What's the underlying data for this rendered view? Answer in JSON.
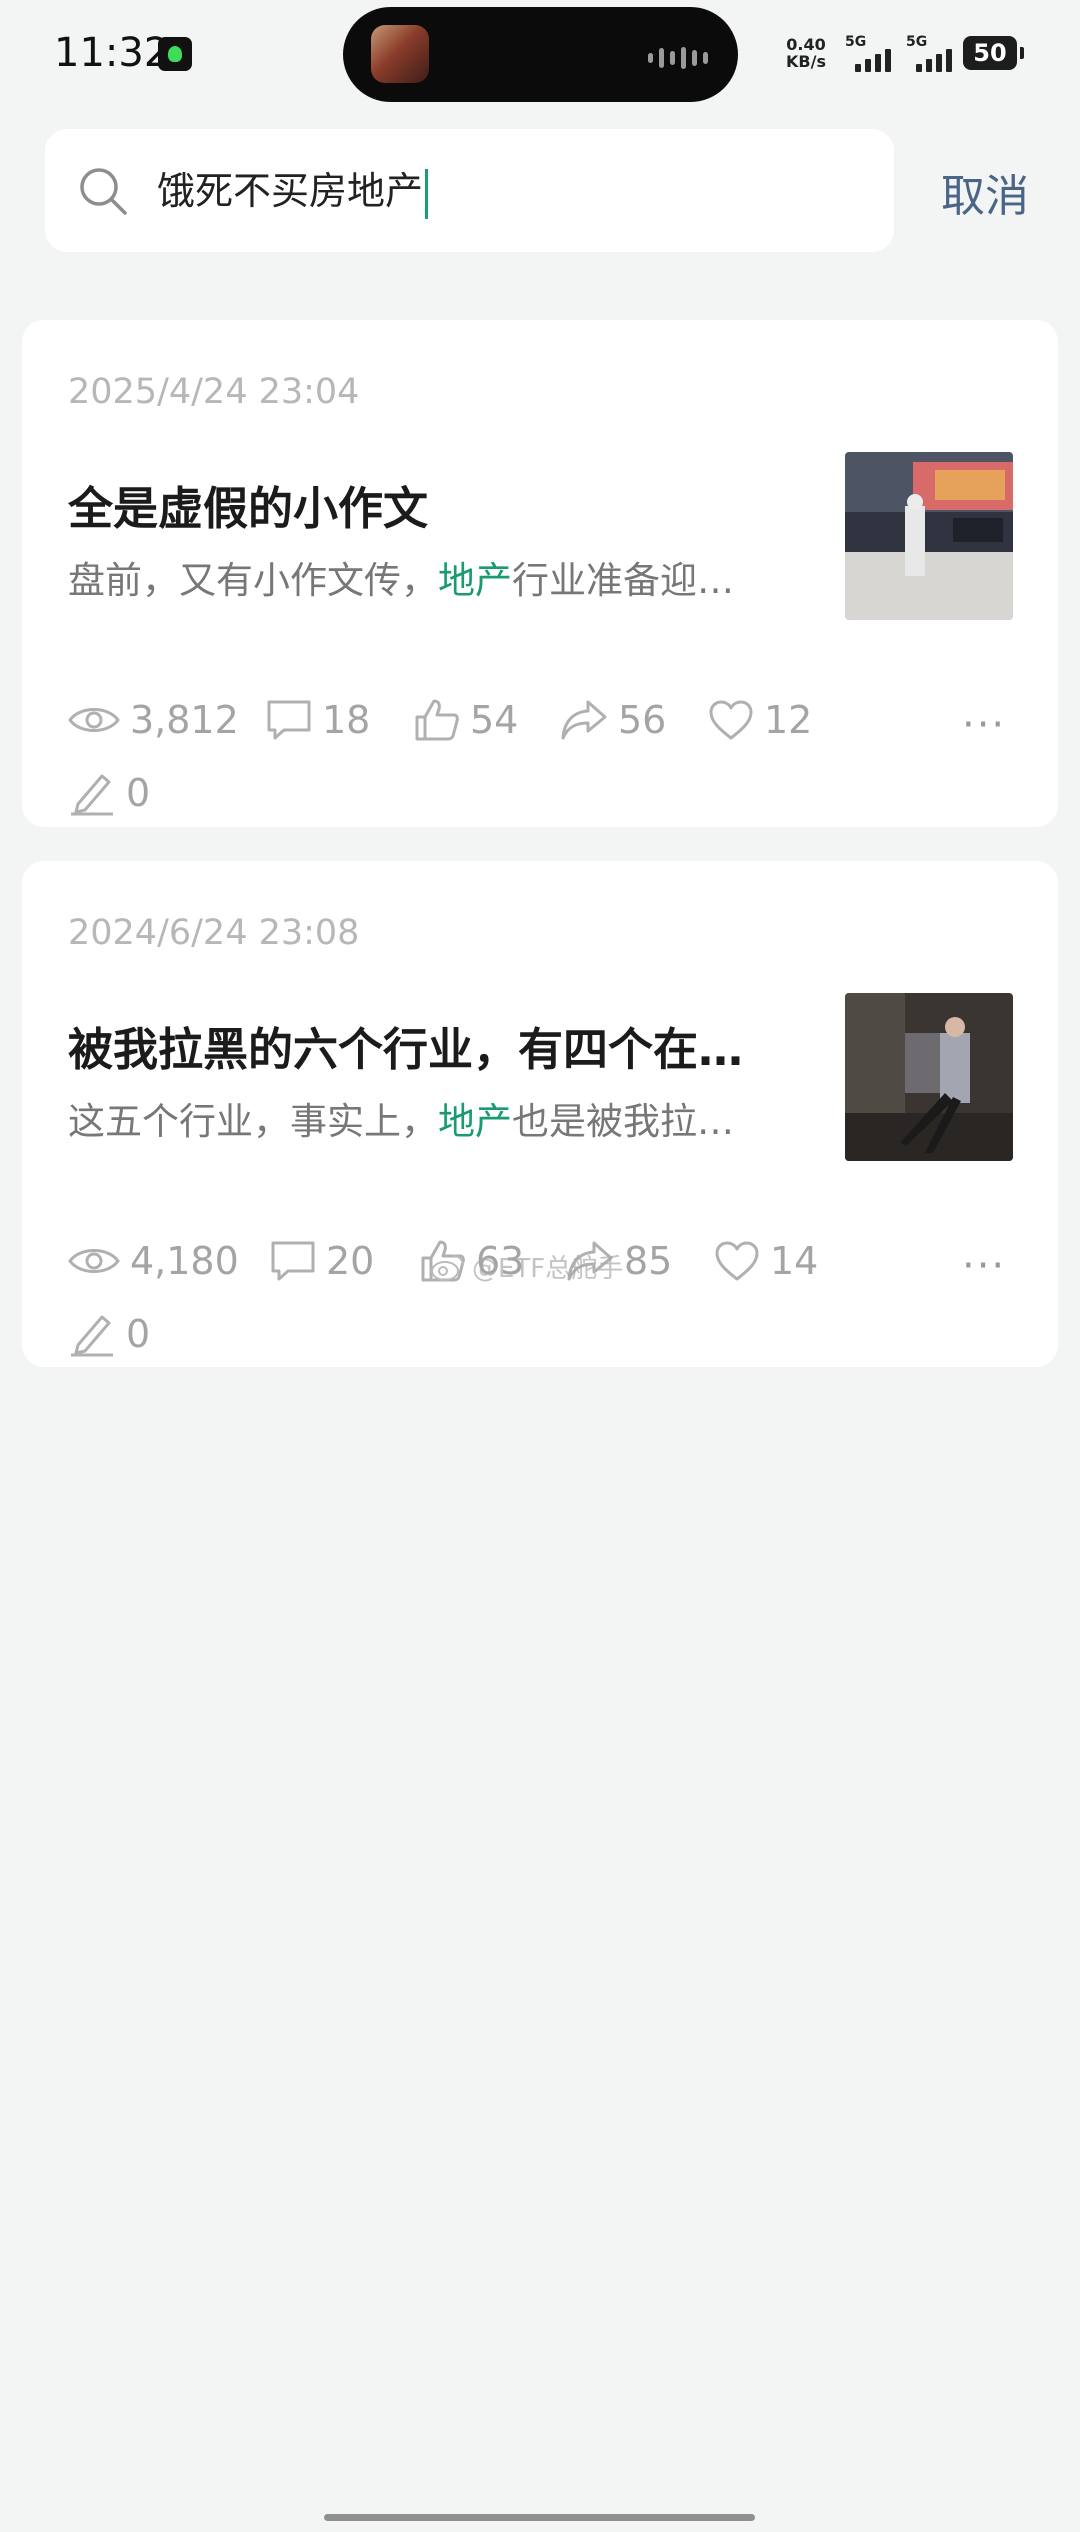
{
  "status_bar": {
    "time": "11:32",
    "net_speed_value": "0.40",
    "net_speed_unit": "KB/s",
    "sim1_label": "5G",
    "sim2_label": "5G",
    "battery": "50"
  },
  "search": {
    "query": "饿死不买房地产",
    "cancel_label": "取消"
  },
  "results": [
    {
      "date": "2025/4/24 23:04",
      "title": "全是虚假的小作文",
      "snippet_before": "盘前，又有小作文传，",
      "snippet_highlight": "地产",
      "snippet_after": "行业准备迎…",
      "stats": {
        "views": "3,812",
        "comments": "18",
        "likes": "54",
        "shares": "56",
        "favorites": "12",
        "edits": "0"
      },
      "more_label": "···"
    },
    {
      "date": "2024/6/24 23:08",
      "title": "被我拉黑的六个行业，有四个在…",
      "snippet_before": "这五个行业，事实上，",
      "snippet_highlight": "地产",
      "snippet_after": "也是被我拉…",
      "stats": {
        "views": "4,180",
        "comments": "20",
        "likes": "63",
        "shares": "85",
        "favorites": "14",
        "edits": "0"
      },
      "more_label": "···"
    }
  ],
  "watermark": "@ETF总舵手",
  "colors": {
    "highlight": "#1a9a72",
    "cancel": "#4a6588",
    "background": "#f3f4f4"
  }
}
